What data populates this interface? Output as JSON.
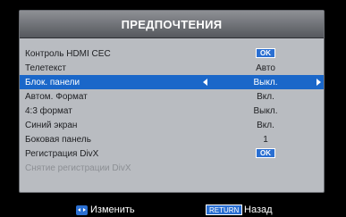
{
  "menu": {
    "title": "ПРЕДПОЧТЕНИЯ",
    "items": [
      {
        "label": "Контроль HDMI CEC",
        "value": "OK",
        "type": "button"
      },
      {
        "label": "Телетекст",
        "value": "Авто",
        "type": "value"
      },
      {
        "label": "Блок. панели",
        "value": "Выкл.",
        "type": "selector",
        "selected": true
      },
      {
        "label": "Автом. Формат",
        "value": "Вкл.",
        "type": "value"
      },
      {
        "label": "4:3 формат",
        "value": "Выкл.",
        "type": "value"
      },
      {
        "label": "Синий экран",
        "value": "Вкл.",
        "type": "value"
      },
      {
        "label": "Боковая панель",
        "value": "1",
        "type": "value"
      },
      {
        "label": "Регистрация DivX",
        "value": "OK",
        "type": "button"
      },
      {
        "label": "Снятие регистрации DivX",
        "value": "",
        "type": "disabled"
      }
    ]
  },
  "footer": {
    "change_label": "Изменить",
    "return_key": "RETURN",
    "back_label": "Назад"
  },
  "colors": {
    "panel": "#b9bcc1",
    "selection": "#1a67c9",
    "accent_blue": "#2a6fd2"
  },
  "icons": {
    "nav": "left-right-arrows-icon"
  }
}
